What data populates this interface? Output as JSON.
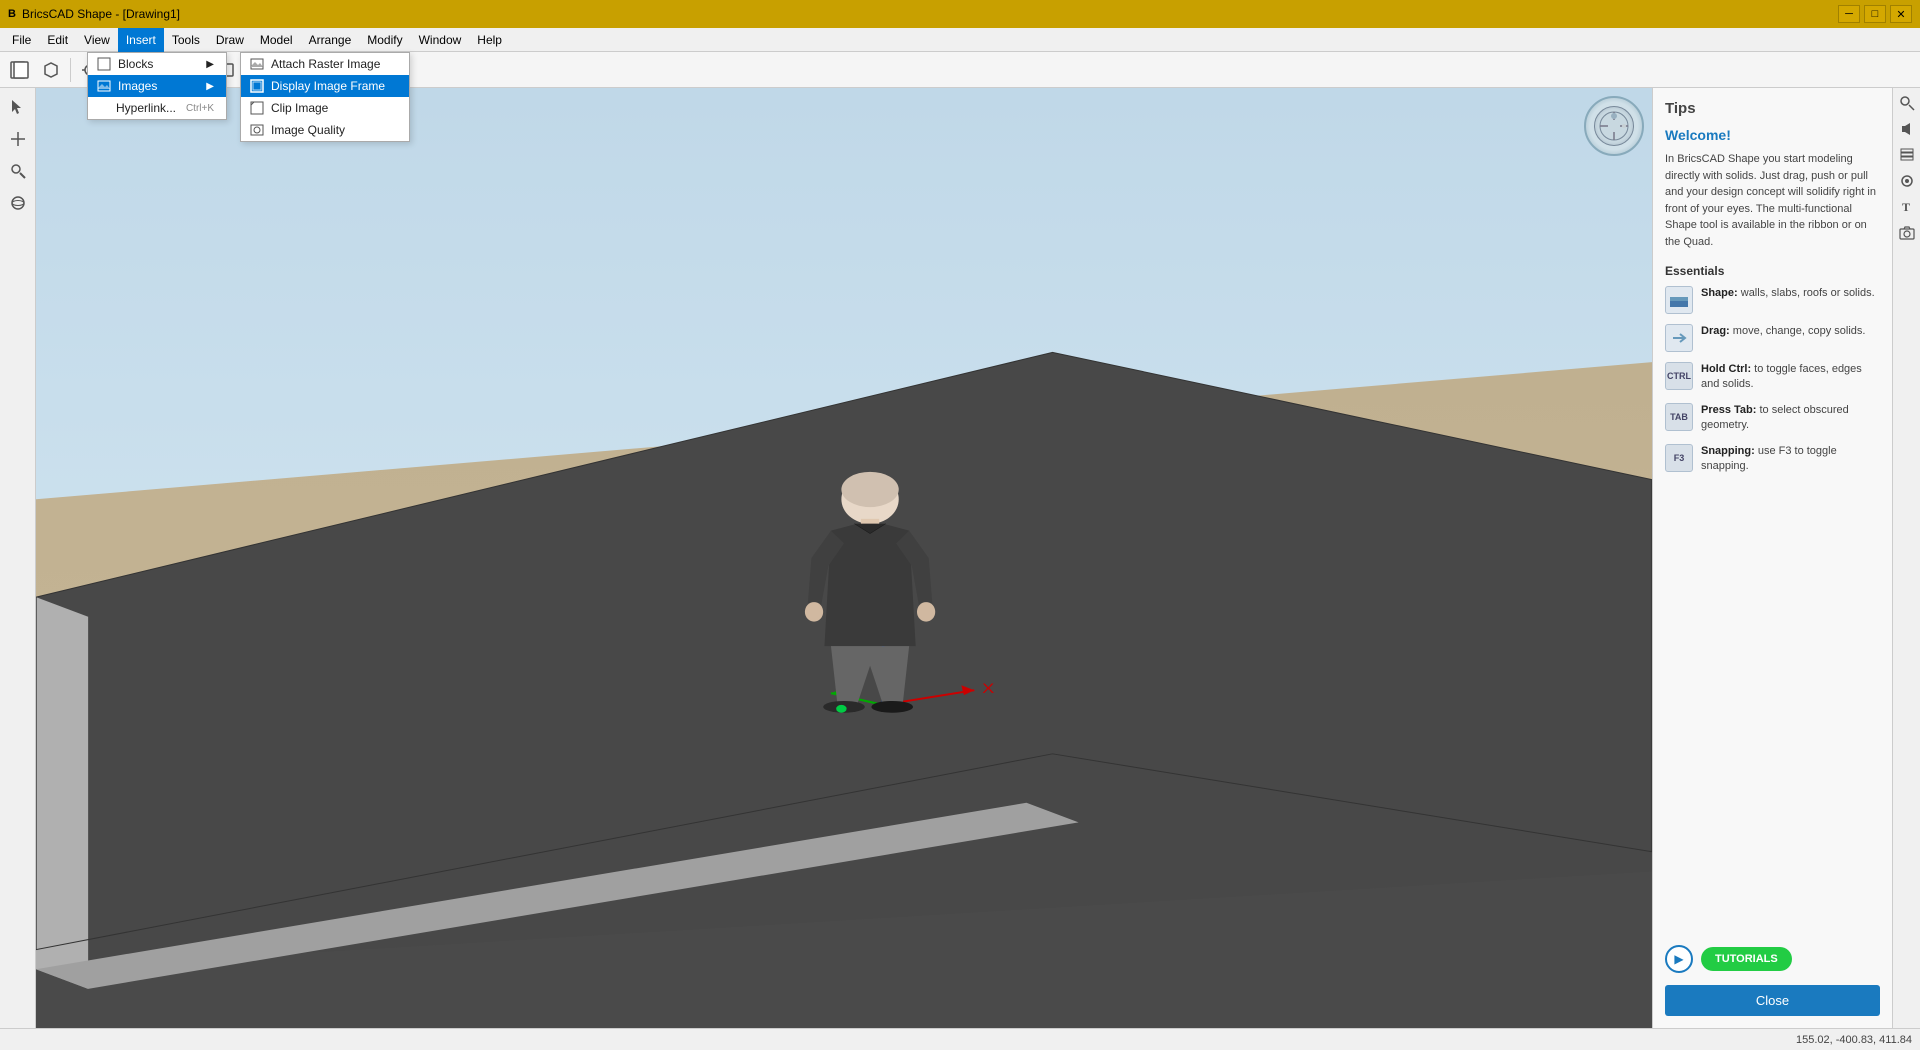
{
  "titlebar": {
    "title": "BricsCAD Shape - [Drawing1]",
    "icon": "B",
    "buttons": {
      "minimize": "─",
      "maximize": "□",
      "close": "✕"
    }
  },
  "menubar": {
    "items": [
      "File",
      "Edit",
      "View",
      "Insert",
      "Tools",
      "Draw",
      "Model",
      "Arrange",
      "Modify",
      "Window",
      "Help"
    ]
  },
  "toolbar": {
    "buttons": [
      {
        "name": "new",
        "icon": "📄"
      },
      {
        "name": "open",
        "icon": "📂"
      },
      {
        "name": "blocks",
        "icon": "⬜"
      },
      {
        "name": "shape",
        "icon": "⬛"
      },
      {
        "name": "snap",
        "icon": "⊕"
      },
      {
        "name": "grid",
        "icon": "⊞"
      },
      {
        "name": "zoom",
        "icon": "🔍"
      },
      {
        "name": "pan",
        "icon": "✋"
      },
      {
        "name": "display",
        "icon": "⊡"
      },
      {
        "name": "attach",
        "icon": "📎"
      },
      {
        "name": "measure",
        "icon": "📏"
      }
    ]
  },
  "insert_menu": {
    "items": [
      {
        "label": "Blocks",
        "has_arrow": true
      },
      {
        "label": "Images",
        "has_arrow": true,
        "active": true
      },
      {
        "label": "Hyperlink...",
        "shortcut": "Ctrl+K"
      }
    ]
  },
  "images_submenu": {
    "items": [
      {
        "label": "Attach Raster Image",
        "icon": "image"
      },
      {
        "label": "Display Image Frame",
        "icon": "frame",
        "highlighted": true
      },
      {
        "label": "Clip Image",
        "icon": "clip"
      },
      {
        "label": "Image Quality",
        "icon": "quality"
      }
    ]
  },
  "tips": {
    "title": "Tips",
    "welcome_title": "Welcome!",
    "welcome_text": "In BricsCAD Shape you start modeling directly with solids. Just drag, push or pull and your design concept will solidify right in front of your eyes. The multi-functional Shape tool is available in the ribbon or on the Quad.",
    "essentials_title": "Essentials",
    "items": [
      {
        "icon": "shape",
        "bold": "Shape:",
        "text": "walls, slabs, roofs or solids."
      },
      {
        "icon": "drag",
        "bold": "Drag:",
        "text": "move, change, copy solids."
      },
      {
        "icon": "ctrl",
        "bold": "Hold Ctrl:",
        "text": "to toggle faces, edges and solids."
      },
      {
        "icon": "tab",
        "bold": "Press Tab:",
        "text": "to select obscured geometry."
      },
      {
        "icon": "f3",
        "bold": "Snapping:",
        "text": "use F3 to toggle snapping."
      }
    ],
    "play_label": "▶",
    "tutorials_label": "TUTORIALS",
    "close_label": "Close"
  },
  "statusbar": {
    "coordinates": "155.02, -400.83, 411.84"
  },
  "right_icons": [
    "🔍",
    "🔊",
    "📋",
    "◉",
    "T",
    "📷"
  ]
}
